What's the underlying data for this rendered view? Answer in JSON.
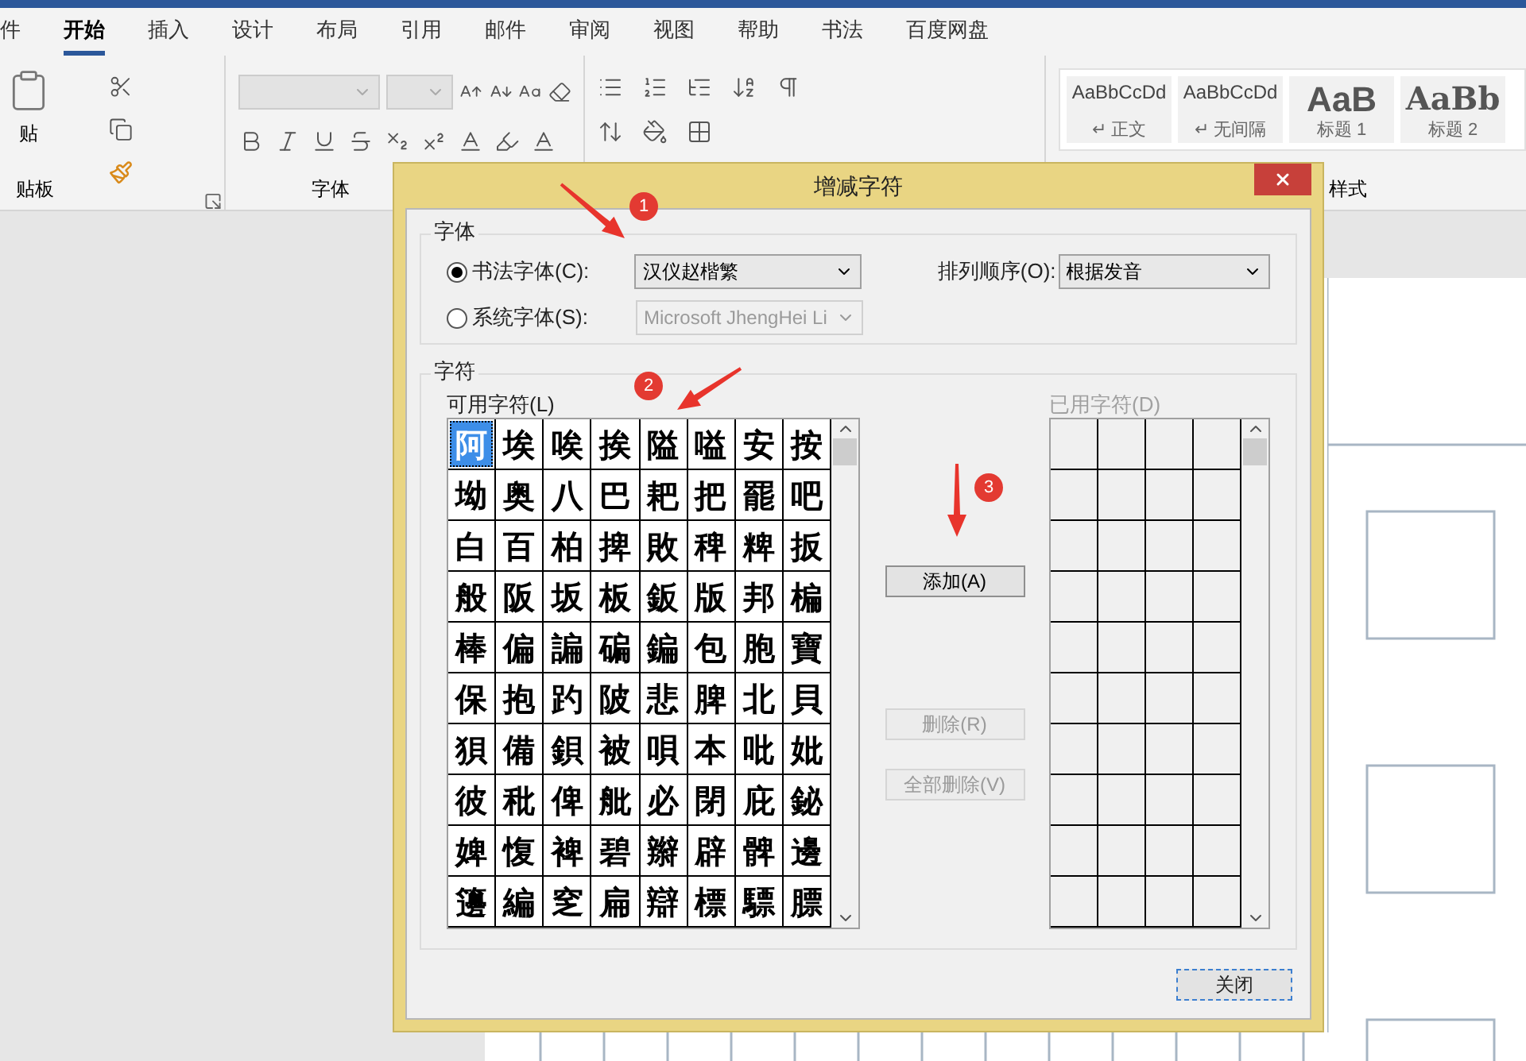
{
  "ribbon_tabs": [
    {
      "label": "件",
      "selected": false
    },
    {
      "label": "开始",
      "selected": true
    },
    {
      "label": "插入",
      "selected": false
    },
    {
      "label": "设计",
      "selected": false
    },
    {
      "label": "布局",
      "selected": false
    },
    {
      "label": "引用",
      "selected": false
    },
    {
      "label": "邮件",
      "selected": false
    },
    {
      "label": "审阅",
      "selected": false
    },
    {
      "label": "视图",
      "selected": false
    },
    {
      "label": "帮助",
      "selected": false
    },
    {
      "label": "书法",
      "selected": false
    },
    {
      "label": "百度网盘",
      "selected": false
    }
  ],
  "clipboard": {
    "paste_label": "贴",
    "group_label": "贴板"
  },
  "font_group": {
    "group_label": "字体"
  },
  "styles": {
    "group_label": "样式",
    "items": [
      {
        "preview": "AaBbCcDd",
        "name": "↵ 正文",
        "kind": "body"
      },
      {
        "preview": "AaBbCcDd",
        "name": "↵ 无间隔",
        "kind": "body"
      },
      {
        "preview": "AaB",
        "name": "标题 1",
        "kind": "heading"
      },
      {
        "preview": "AaBb",
        "name": "标题 2",
        "kind": "heading2"
      }
    ]
  },
  "dialog": {
    "title": "增减字符",
    "font_section": {
      "title": "字体",
      "calligraphy": {
        "label": "书法字体(C):",
        "selected": true,
        "value": "汉仪赵楷繁"
      },
      "system": {
        "label": "系统字体(S):",
        "selected": false,
        "value": "Microsoft JhengHei Li",
        "disabled": true
      },
      "sort": {
        "label": "排列顺序(O):",
        "value": "根据发音"
      }
    },
    "char_section": {
      "title": "字符",
      "available_label": "可用字符(L)",
      "used_label": "已用字符(D)",
      "used_disabled": true,
      "characters": [
        {
          "char": "阿",
          "selected": true
        },
        {
          "char": "埃",
          "selected": false
        },
        {
          "char": "唉",
          "selected": false
        },
        {
          "char": "挨",
          "selected": false
        },
        {
          "char": "隘",
          "selected": false
        },
        {
          "char": "嗌",
          "selected": false
        },
        {
          "char": "安",
          "selected": false
        },
        {
          "char": "按",
          "selected": false
        },
        {
          "char": "坳",
          "selected": false
        },
        {
          "char": "奥",
          "selected": false
        },
        {
          "char": "八",
          "selected": false
        },
        {
          "char": "巴",
          "selected": false
        },
        {
          "char": "耙",
          "selected": false
        },
        {
          "char": "把",
          "selected": false
        },
        {
          "char": "罷",
          "selected": false
        },
        {
          "char": "吧",
          "selected": false
        },
        {
          "char": "白",
          "selected": false
        },
        {
          "char": "百",
          "selected": false
        },
        {
          "char": "柏",
          "selected": false
        },
        {
          "char": "捭",
          "selected": false
        },
        {
          "char": "敗",
          "selected": false
        },
        {
          "char": "稗",
          "selected": false
        },
        {
          "char": "粺",
          "selected": false
        },
        {
          "char": "扳",
          "selected": false
        },
        {
          "char": "般",
          "selected": false
        },
        {
          "char": "阪",
          "selected": false
        },
        {
          "char": "坂",
          "selected": false
        },
        {
          "char": "板",
          "selected": false
        },
        {
          "char": "鈑",
          "selected": false
        },
        {
          "char": "版",
          "selected": false
        },
        {
          "char": "邦",
          "selected": false
        },
        {
          "char": "楄",
          "selected": false
        },
        {
          "char": "棒",
          "selected": false
        },
        {
          "char": "偏",
          "selected": false
        },
        {
          "char": "諞",
          "selected": false
        },
        {
          "char": "碥",
          "selected": false
        },
        {
          "char": "鍽",
          "selected": false
        },
        {
          "char": "包",
          "selected": false
        },
        {
          "char": "胞",
          "selected": false
        },
        {
          "char": "寶",
          "selected": false
        },
        {
          "char": "保",
          "selected": false
        },
        {
          "char": "抱",
          "selected": false
        },
        {
          "char": "趵",
          "selected": false
        },
        {
          "char": "陂",
          "selected": false
        },
        {
          "char": "悲",
          "selected": false
        },
        {
          "char": "脾",
          "selected": false
        },
        {
          "char": "北",
          "selected": false
        },
        {
          "char": "貝",
          "selected": false
        },
        {
          "char": "狽",
          "selected": false
        },
        {
          "char": "備",
          "selected": false
        },
        {
          "char": "鋇",
          "selected": false
        },
        {
          "char": "被",
          "selected": false
        },
        {
          "char": "唄",
          "selected": false
        },
        {
          "char": "本",
          "selected": false
        },
        {
          "char": "吡",
          "selected": false
        },
        {
          "char": "妣",
          "selected": false
        },
        {
          "char": "彼",
          "selected": false
        },
        {
          "char": "秕",
          "selected": false
        },
        {
          "char": "俾",
          "selected": false
        },
        {
          "char": "舭",
          "selected": false
        },
        {
          "char": "必",
          "selected": false
        },
        {
          "char": "閉",
          "selected": false
        },
        {
          "char": "庇",
          "selected": false
        },
        {
          "char": "鉍",
          "selected": false
        },
        {
          "char": "婢",
          "selected": false
        },
        {
          "char": "愎",
          "selected": false
        },
        {
          "char": "裨",
          "selected": false
        },
        {
          "char": "碧",
          "selected": false
        },
        {
          "char": "辮",
          "selected": false
        },
        {
          "char": "辟",
          "selected": false
        },
        {
          "char": "髀",
          "selected": false
        },
        {
          "char": "邊",
          "selected": false
        },
        {
          "char": "籩",
          "selected": false
        },
        {
          "char": "編",
          "selected": false
        },
        {
          "char": "窆",
          "selected": false
        },
        {
          "char": "扁",
          "selected": false
        },
        {
          "char": "辯",
          "selected": false
        },
        {
          "char": "標",
          "selected": false
        },
        {
          "char": "驃",
          "selected": false
        },
        {
          "char": "膘",
          "selected": false
        }
      ]
    },
    "buttons": [
      {
        "label": "添加(A)",
        "disabled": false
      },
      {
        "label": "删除(R)",
        "disabled": true
      },
      {
        "label": "全部删除(V)",
        "disabled": true
      }
    ],
    "close_label": "关闭"
  },
  "annotations": [
    "1",
    "2",
    "3"
  ]
}
